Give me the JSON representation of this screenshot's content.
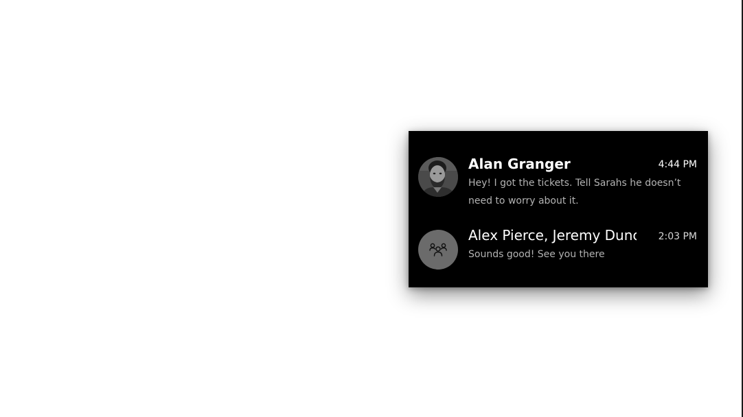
{
  "conversations": [
    {
      "name": "Alan Granger",
      "time": "4:44 PM",
      "preview": "Hey! I got the tickets. Tell Sarahs he doesn’t need to worry about it.",
      "avatar": "person-photo"
    },
    {
      "name": "Alex Pierce, Jeremy Dunc",
      "time": "2:03 PM",
      "preview": "Sounds good! See you there",
      "avatar": "group-icon"
    }
  ],
  "colors": {
    "panel_background": "#000000",
    "name_text": "#ffffff",
    "preview_text": "#b3b3b3",
    "group_avatar": "#6b6b6b"
  }
}
